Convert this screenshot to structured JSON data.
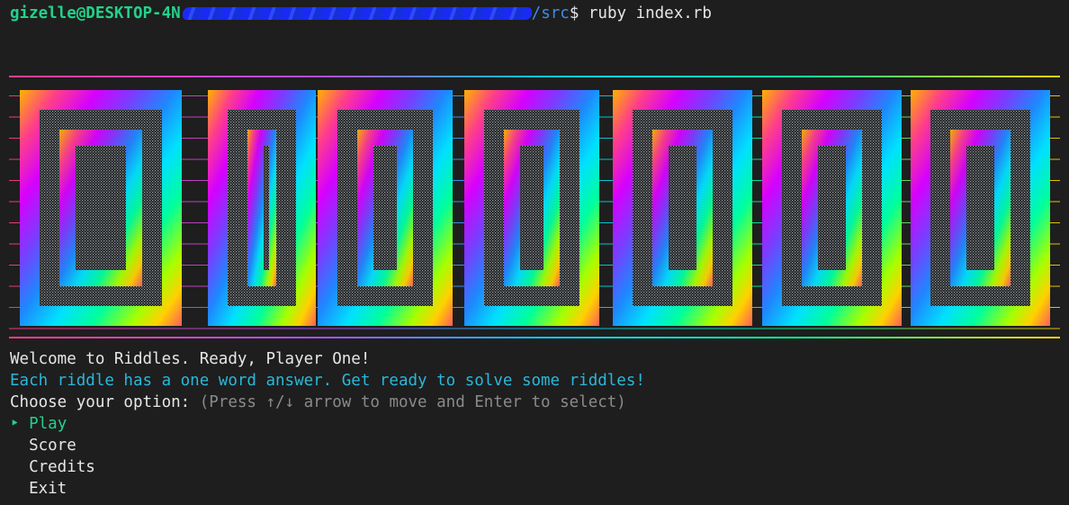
{
  "terminal": {
    "prompt": {
      "user_host_visible": "gizelle@DESKTOP-4N",
      "path_tail": "/src",
      "dollar": "$",
      "command": " ruby index.rb"
    },
    "banner_text": "RIDDLES",
    "welcome": "Welcome to Riddles. Ready, Player One!",
    "info": "Each riddle has a one word answer. Get ready to solve some riddles!",
    "choose": "Choose your option:",
    "hint": " (Press ↑/↓ arrow to move and Enter to select)",
    "menu": {
      "pointer": "‣",
      "items": [
        "Play",
        "Score",
        "Credits",
        "Exit"
      ],
      "selected_index": 0
    }
  },
  "colors": {
    "background": "#1e1e1e",
    "prompt_user": "#23d18b",
    "prompt_path": "#3b8eea",
    "info_text": "#29b8db",
    "hint_text": "#8a8a8a",
    "selected_item": "#23d18b"
  }
}
